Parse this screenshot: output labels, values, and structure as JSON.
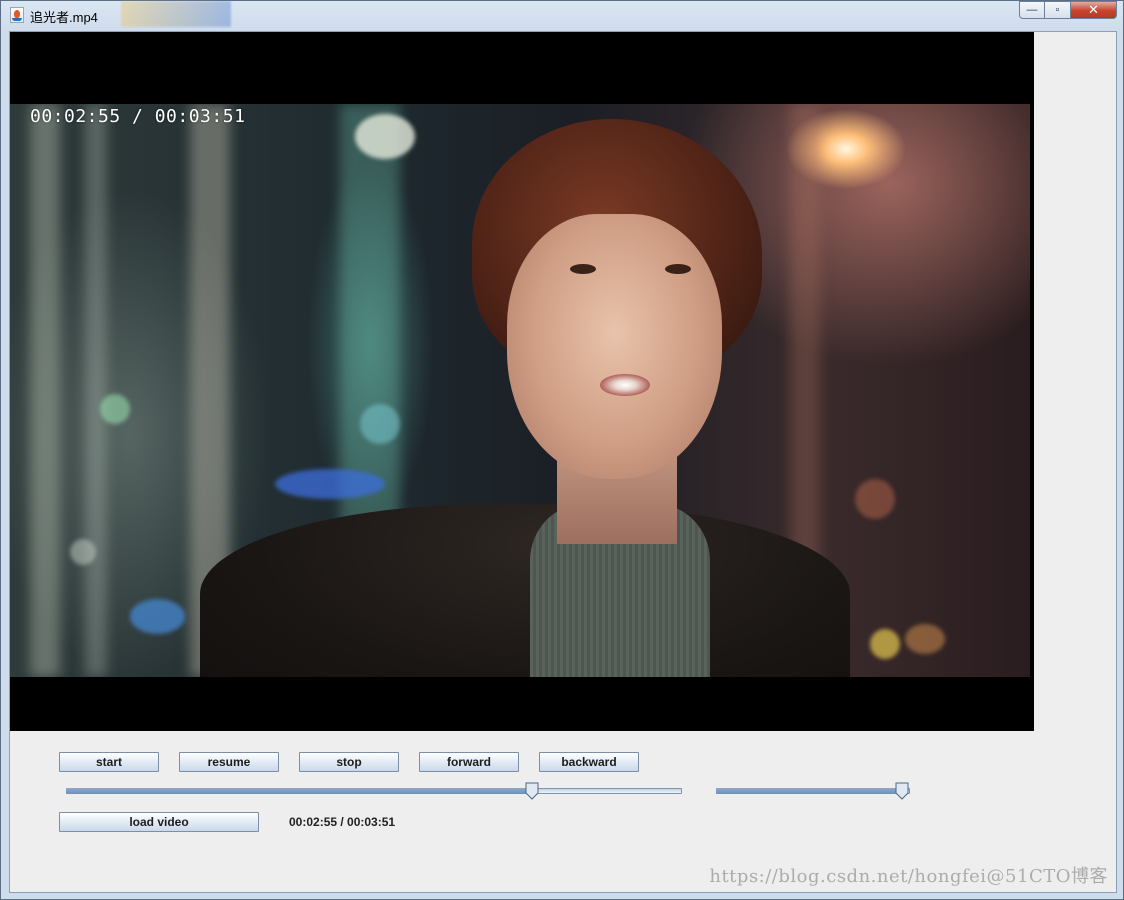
{
  "window": {
    "title": "追光者.mp4",
    "minimize_symbol": "—",
    "maximize_symbol": "▫",
    "close_symbol": "✕"
  },
  "video": {
    "osd_time": "00:02:55 / 00:03:51"
  },
  "controls": {
    "buttons": {
      "start": "start",
      "resume": "resume",
      "stop": "stop",
      "forward": "forward",
      "backward": "backward",
      "load_video": "load video"
    },
    "progress_slider": {
      "value_fraction": 0.756
    },
    "volume_slider": {
      "value_fraction": 0.96
    },
    "time_label": "00:02:55 / 00:03:51"
  },
  "watermark": "https://blog.csdn.net/hongfei@51CTO博客",
  "colors": {
    "button_border": "#7b8fa6",
    "slider_thumb": "#dfe8f3",
    "slider_thumb_border": "#4d6684"
  },
  "icons": {
    "app_icon": "java-coffee-cup-icon",
    "minimize": "minimize-icon",
    "maximize": "maximize-icon",
    "close": "close-icon"
  }
}
